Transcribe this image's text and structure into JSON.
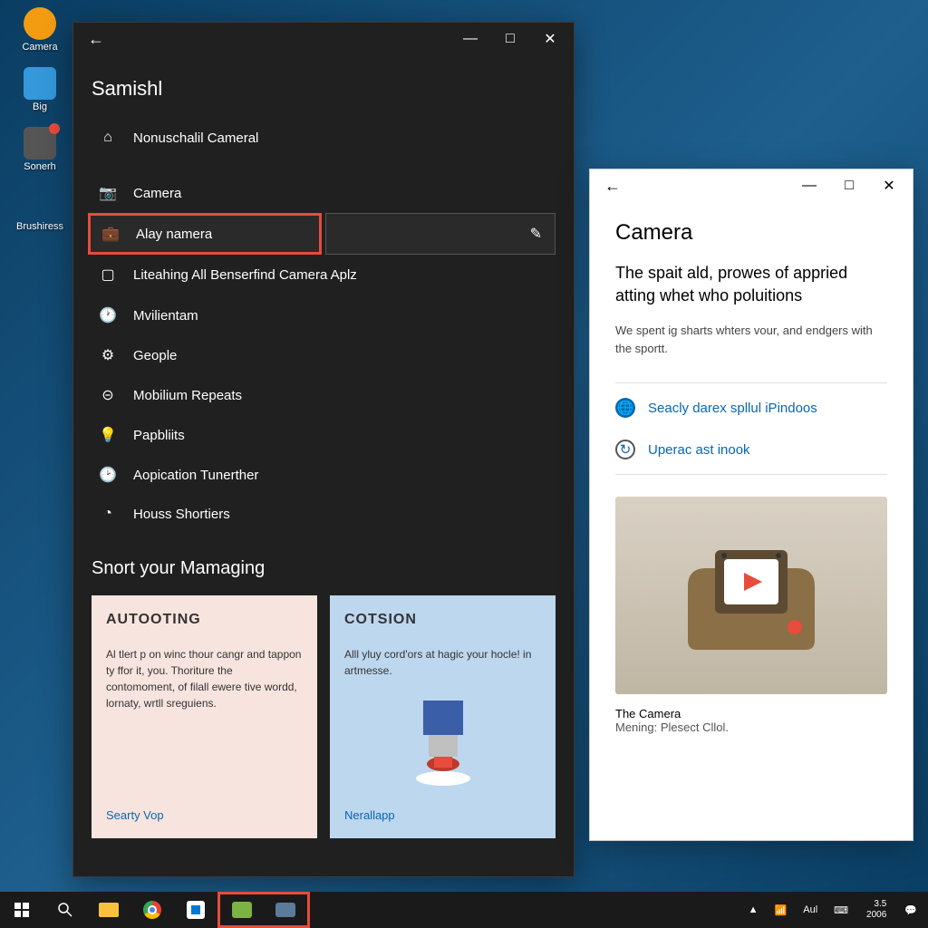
{
  "desktop": {
    "icons": [
      {
        "label": "Camera"
      },
      {
        "label": "Big"
      },
      {
        "label": "Sonerh"
      },
      {
        "label": "Brushiress"
      }
    ]
  },
  "settings": {
    "title": "Samishl",
    "home": "Nonuschalil Cameral",
    "nav": [
      {
        "icon": "camera-icon",
        "label": "Camera"
      },
      {
        "icon": "bag-icon",
        "label": "Alay namera",
        "highlighted": true
      },
      {
        "icon": "square-icon",
        "label": "Liteahing All Benserfind Camera Aplz"
      },
      {
        "icon": "clock-icon",
        "label": "Mvilientam"
      },
      {
        "icon": "gear-icon",
        "label": "Geople"
      },
      {
        "icon": "ring-icon",
        "label": "Mobilium Repeats"
      },
      {
        "icon": "bulb-icon",
        "label": "Papbliits"
      },
      {
        "icon": "clock2-icon",
        "label": "Aopication Tunerther"
      },
      {
        "icon": "progress-icon",
        "label": "Houss Shortiers"
      }
    ],
    "section_title": "Snort your Mamaging",
    "cards": [
      {
        "title": "AUTOOTING",
        "body": "Al tlert p on winc thour cangr and tappon ty ffor it, you. Thoriture the contomoment, of filall ewere tive wordd, lornaty, wrtll sreguiens.",
        "link": "Searty Vop"
      },
      {
        "title": "COTSION",
        "body": "Alll yluy cord'ors at hagic your hocle! in artmesse.",
        "link": "Nerallapp"
      }
    ]
  },
  "camera": {
    "title": "Camera",
    "subtitle": "The spait ald, prowes of appried atting whet who poluitions",
    "desc": "We spent ig sharts whters vour, and endgers with the sportt.",
    "links": [
      {
        "label": "Seacly darex spllul iPindoos"
      },
      {
        "label": "Uperac ast inook"
      }
    ],
    "caption": "The Camera",
    "caption2": "Mening: Plesect Cllol."
  },
  "taskbar": {
    "time": "3.5",
    "date": "2006",
    "lang": "Aul"
  }
}
